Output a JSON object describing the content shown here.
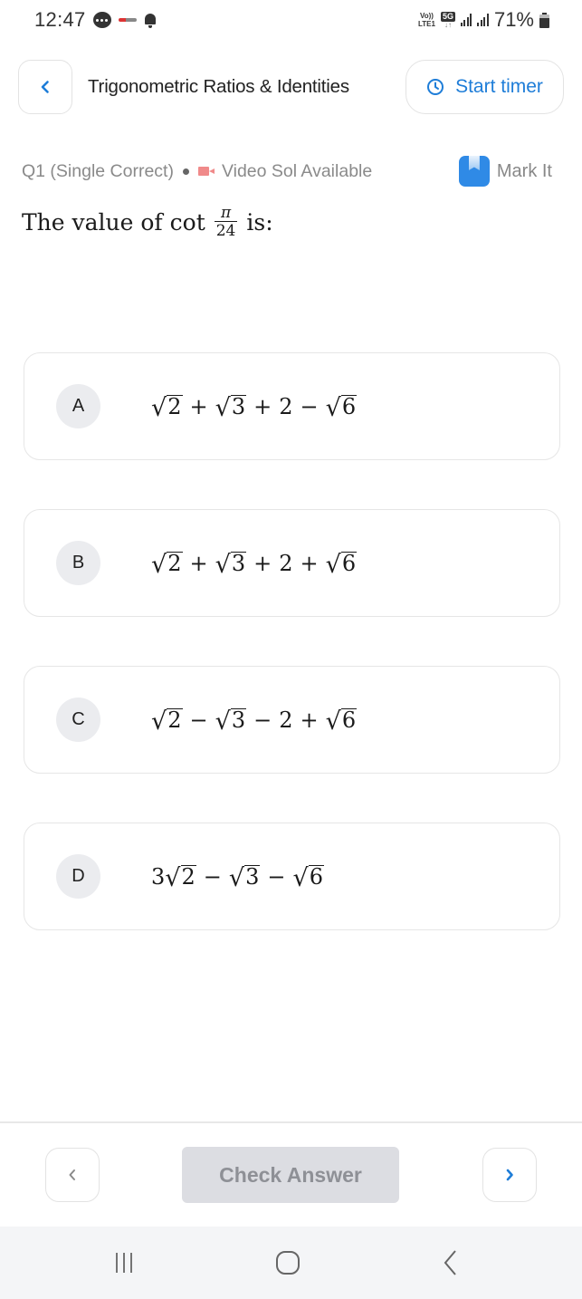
{
  "status_bar": {
    "time": "12:47",
    "left_icons": [
      "chat-icon",
      "app-notification-icon",
      "bell-icon"
    ],
    "network_label_top": "Vo))",
    "network_label_bottom": "LTE1",
    "network_type": "5G",
    "network_arrows": "↓↑",
    "battery_percent": "71%"
  },
  "header": {
    "back_icon": "chevron-left-icon",
    "title": "Trigonometric Ratios & Identities",
    "timer_icon": "clock-icon",
    "timer_label": "Start timer"
  },
  "meta": {
    "question_label": "Q1 (Single Correct)",
    "video_icon": "video-icon",
    "video_label": "Video Sol Available",
    "mark_icon": "bookmark-icon",
    "mark_label": "Mark It"
  },
  "question": {
    "prefix": "The value of cot",
    "fraction_numerator": "π",
    "fraction_denominator": "24",
    "suffix": "is:"
  },
  "options": [
    {
      "letter": "A",
      "text": "√2 + √3 + 2 − √6",
      "terms": [
        {
          "op": "",
          "coef": "",
          "radicand": "2"
        },
        {
          "op": "+",
          "coef": "",
          "radicand": "3"
        },
        {
          "op": "+",
          "coef": "2",
          "radicand": ""
        },
        {
          "op": "−",
          "coef": "",
          "radicand": "6"
        }
      ]
    },
    {
      "letter": "B",
      "text": "√2 + √3 + 2 + √6",
      "terms": [
        {
          "op": "",
          "coef": "",
          "radicand": "2"
        },
        {
          "op": "+",
          "coef": "",
          "radicand": "3"
        },
        {
          "op": "+",
          "coef": "2",
          "radicand": ""
        },
        {
          "op": "+",
          "coef": "",
          "radicand": "6"
        }
      ]
    },
    {
      "letter": "C",
      "text": "√2 − √3 − 2 + √6",
      "terms": [
        {
          "op": "",
          "coef": "",
          "radicand": "2"
        },
        {
          "op": "−",
          "coef": "",
          "radicand": "3"
        },
        {
          "op": "−",
          "coef": "2",
          "radicand": ""
        },
        {
          "op": "+",
          "coef": "",
          "radicand": "6"
        }
      ]
    },
    {
      "letter": "D",
      "text": "3√2 − √3 − √6",
      "terms": [
        {
          "op": "",
          "coef": "3",
          "radicand": "2"
        },
        {
          "op": "−",
          "coef": "",
          "radicand": "3"
        },
        {
          "op": "−",
          "coef": "",
          "radicand": "6"
        }
      ]
    }
  ],
  "footer": {
    "prev_icon": "chevron-left-icon",
    "check_label": "Check Answer",
    "next_icon": "chevron-right-icon"
  },
  "system_nav": {
    "recents_icon": "recents-icon",
    "home_icon": "home-icon",
    "back_icon": "back-icon"
  },
  "colors": {
    "accent": "#1e7dd8",
    "bookmark": "#2f8ae6",
    "video_icon": "#f08a8a",
    "check_button_bg": "#dcdde2",
    "check_button_text": "#8e9096",
    "option_badge_bg": "#ebecef"
  }
}
